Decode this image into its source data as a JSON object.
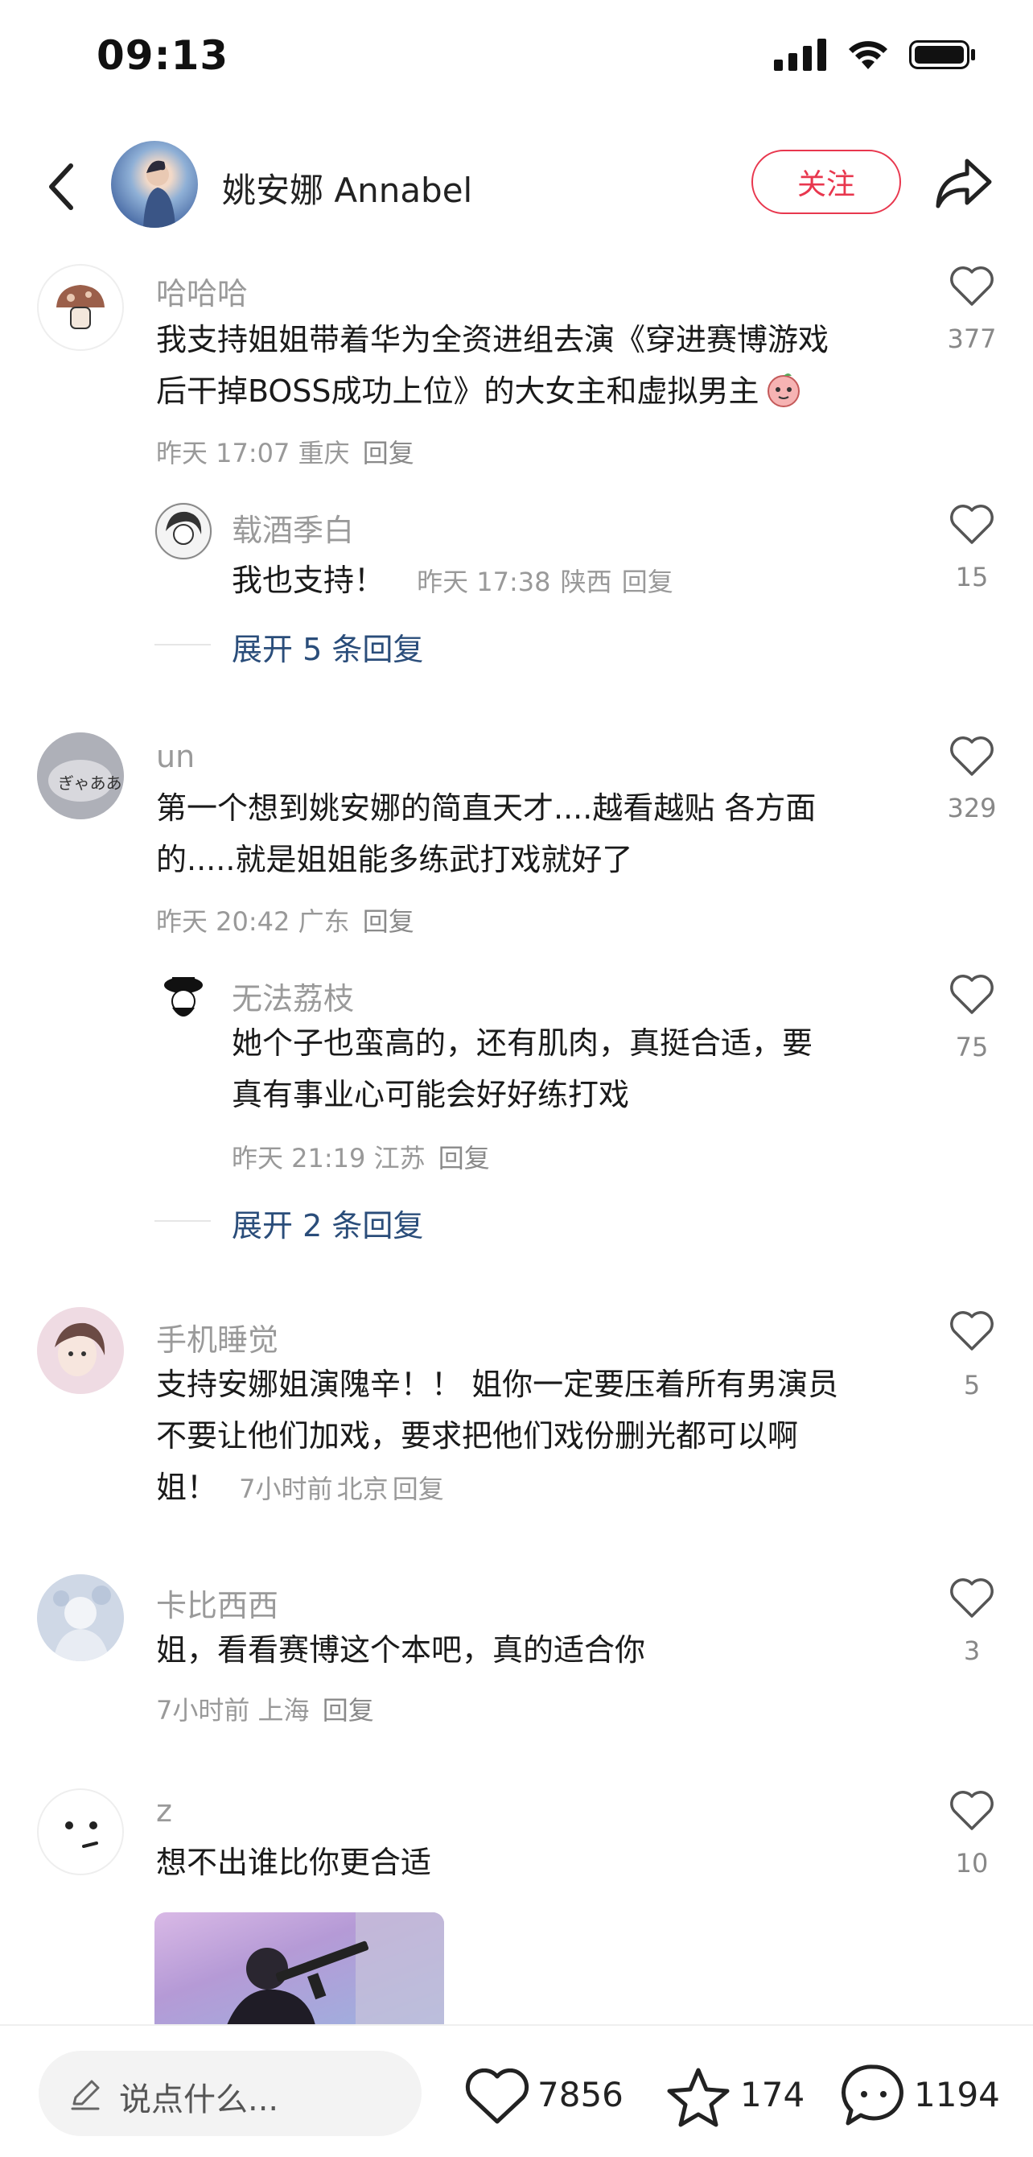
{
  "status_bar": {
    "time": "09:13"
  },
  "header": {
    "title": "姚安娜 Annabel",
    "follow_label": "关注"
  },
  "comments": [
    {
      "username": "哈哈哈",
      "text_lines": [
        "我支持姐姐带着华为全资进组去演《穿进赛博游戏",
        "后干掉BOSS成功上位》的大女主和虚拟男主"
      ],
      "time": "昨天 17:07",
      "location": "重庆",
      "reply_label": "回复",
      "likes": "377",
      "replies": [
        {
          "username": "载酒季白",
          "text": "我也支持！",
          "time": "昨天 17:38",
          "location": "陕西",
          "reply_label": "回复",
          "likes": "15"
        }
      ],
      "expand_label": "展开 5 条回复"
    },
    {
      "username": "un",
      "text_lines": [
        "第一个想到姚安娜的简直天才....越看越贴 各方面",
        "的.....就是姐姐能多练武打戏就好了"
      ],
      "time": "昨天 20:42",
      "location": "广东",
      "reply_label": "回复",
      "likes": "329",
      "replies": [
        {
          "username": "无法荔枝",
          "text_lines": [
            "她个子也蛮高的，还有肌肉，真挺合适，要",
            "真有事业心可能会好好练打戏"
          ],
          "time": "昨天 21:19",
          "location": "江苏",
          "reply_label": "回复",
          "likes": "75"
        }
      ],
      "expand_label": "展开 2 条回复"
    },
    {
      "username": "手机睡觉",
      "text_lines": [
        "支持安娜姐演隗辛！！ 姐你一定要压着所有男演员",
        "不要让他们加戏，要求把他们戏份删光都可以啊",
        "姐！"
      ],
      "time": "7小时前",
      "location": "北京",
      "reply_label": "回复",
      "likes": "5"
    },
    {
      "username": "卡比西西",
      "text": "姐，看看赛博这个本吧，真的适合你",
      "time": "7小时前",
      "location": "上海",
      "reply_label": "回复",
      "likes": "3"
    },
    {
      "username": "z",
      "text": "想不出谁比你更合适",
      "likes": "10"
    }
  ],
  "bottom_bar": {
    "input_placeholder": "说点什么...",
    "likes": "7856",
    "favorites": "174",
    "comments": "1194"
  },
  "icons": [
    "back-icon",
    "share-icon",
    "heart-icon",
    "star-icon",
    "chat-icon",
    "pencil-icon",
    "signal-icon",
    "wifi-icon",
    "battery-icon"
  ],
  "colors": {
    "follow": "#e8374e",
    "expand_link": "#2a4d7a"
  }
}
